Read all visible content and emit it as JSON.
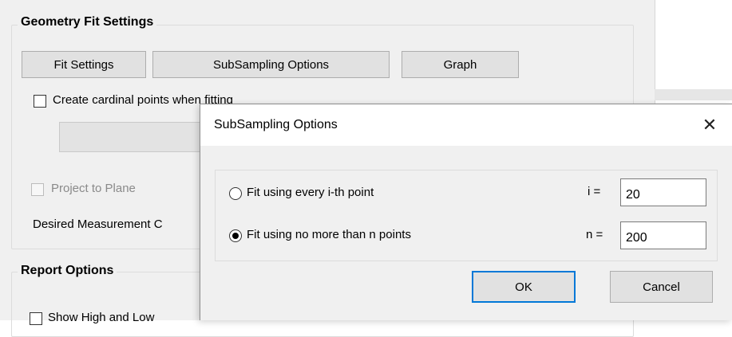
{
  "geometry_fit": {
    "title": "Geometry Fit Settings",
    "buttons": {
      "fit_settings": "Fit Settings",
      "subsampling": "SubSampling Options",
      "graph": "Graph"
    },
    "create_cardinal": {
      "label": "Create cardinal points when fitting",
      "checked": false
    },
    "project_to_plane": {
      "label": "Project to Plane",
      "checked": false,
      "disabled": true
    },
    "desired_measurement": "Desired Measurement C"
  },
  "report_options": {
    "title": "Report Options",
    "show_high_low": {
      "label": "Show High and Low",
      "checked": false
    }
  },
  "dialog": {
    "title": "SubSampling Options",
    "close_icon": "close-icon",
    "options": [
      {
        "label": "Fit using every i-th point",
        "var_label": "i =",
        "value": "20",
        "selected": false
      },
      {
        "label": "Fit using no more than n points",
        "var_label": "n =",
        "value": "200",
        "selected": true
      }
    ],
    "ok_label": "OK",
    "cancel_label": "Cancel",
    "accent": "#0078d7"
  }
}
